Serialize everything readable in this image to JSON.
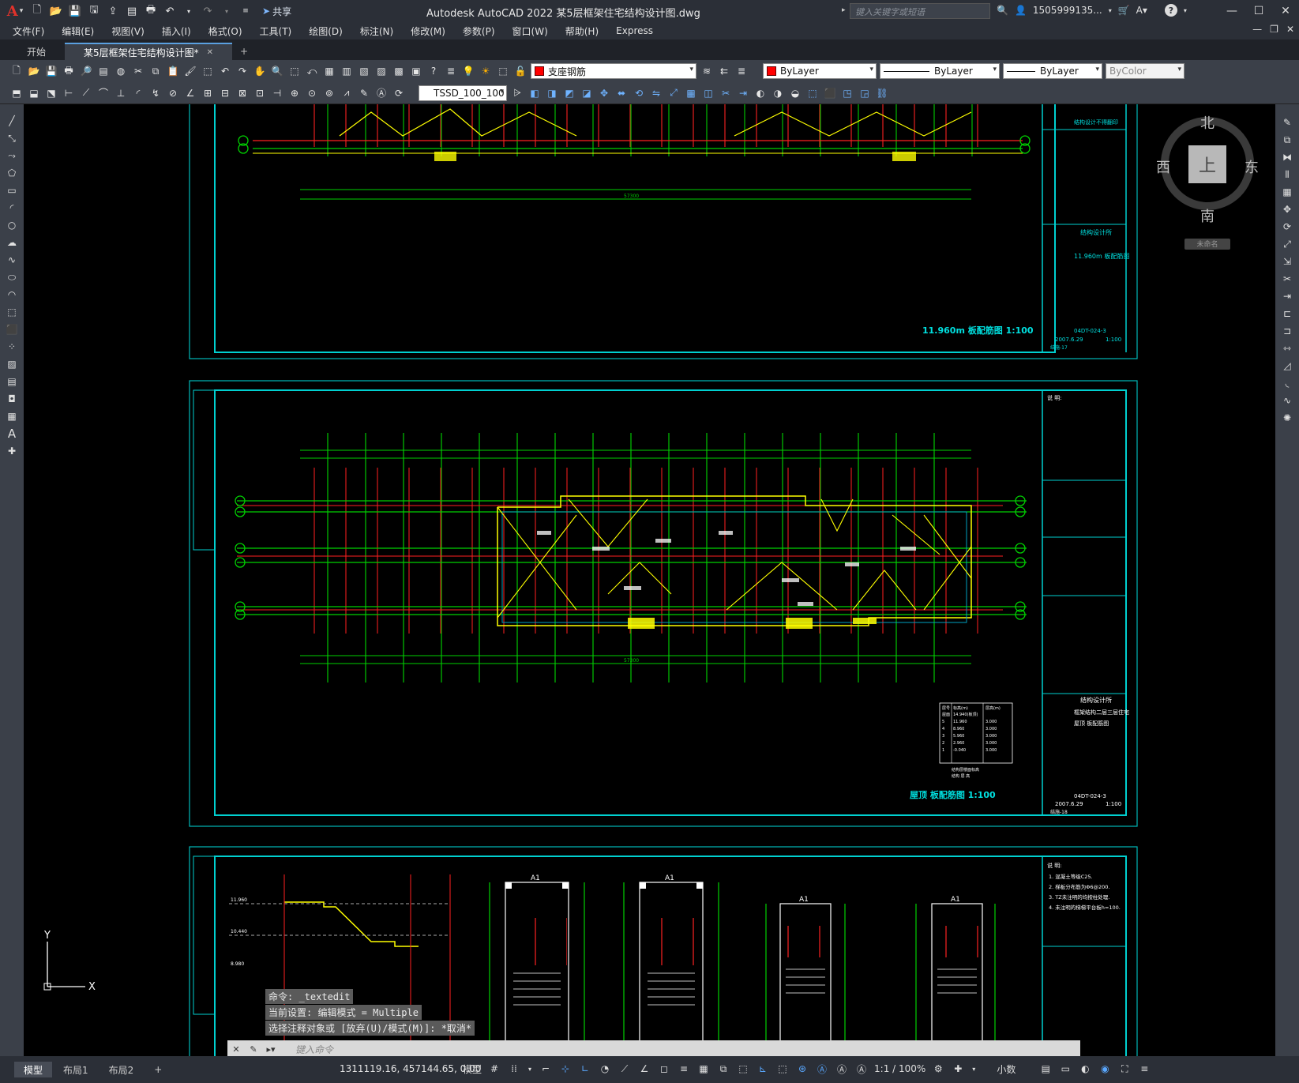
{
  "app": {
    "logo": "A",
    "title": "Autodesk AutoCAD 2022    某5层框架住宅结构设计图.dwg",
    "share_label": "共享",
    "search_placeholder": "键入关键字或短语",
    "user": "1505999135...",
    "help": "?"
  },
  "menu": [
    "文件(F)",
    "编辑(E)",
    "视图(V)",
    "插入(I)",
    "格式(O)",
    "工具(T)",
    "绘图(D)",
    "标注(N)",
    "修改(M)",
    "参数(P)",
    "窗口(W)",
    "帮助(H)",
    "Express"
  ],
  "tabs": [
    {
      "label": "开始",
      "active": false
    },
    {
      "label": "某5层框架住宅结构设计图*",
      "active": true
    },
    {
      "label": "+",
      "active": false
    }
  ],
  "properties": {
    "layer": "支座钢筋",
    "color": "ByLayer",
    "linetype": "ByLayer",
    "lineweight": "ByLayer",
    "plotstyle": "ByColor",
    "textstyle": "TSSD_100_100",
    "layer_color": "#ff0000"
  },
  "viewcube": {
    "north": "北",
    "south": "南",
    "east": "东",
    "west": "西",
    "face": "上",
    "wcs": "未命名"
  },
  "drawing": {
    "sheet1_title": "11.960m 板配筋图 1:100",
    "sheet2_title": "屋顶 板配筋图 1:100",
    "designer": "结构设计所",
    "sheet1_tb_label": "11.960m 板配筋图",
    "sheet2_tb_label1": "框架结构二层三层住宅",
    "sheet2_tb_label2": "屋顶 板配筋图",
    "drawing_no": "04DT-024-3",
    "date": "2007.6.29",
    "scale_a": "1:100",
    "sheet1_no": "结施-17",
    "sheet2_no": "结施-18",
    "total_dim": "57300",
    "ucs_x": "X",
    "ucs_y": "Y",
    "notes_title": "说 明:",
    "stair_notes": [
      "1. 混凝土等级C25.",
      "2. 梯板分布筋为Φ6@200.",
      "3. TZ未注明的均按柱处理.",
      "4. 未注明的梯梯平台板h=100."
    ],
    "stair_label": "A1",
    "elev_labels": [
      "11.960",
      "10.440",
      "8.980"
    ],
    "floor_table_header": [
      "层号",
      "标高(m)",
      "层高(m)"
    ],
    "floor_table": [
      [
        "屋面",
        "14.940(板顶)",
        ""
      ],
      [
        "5",
        "11.960",
        "3.000"
      ],
      [
        "4",
        "8.960",
        "3.000"
      ],
      [
        "3",
        "5.960",
        "3.000"
      ],
      [
        "2",
        "2.960",
        "3.000"
      ],
      [
        "1",
        "-0.040",
        "3.000"
      ]
    ],
    "floor_table_note": "结构层楼面标高",
    "floor_table_sub": "结构 层 高"
  },
  "command": {
    "history": [
      "命令: _textedit",
      "当前设置: 编辑模式 = Multiple",
      "选择注释对象或 [放弃(U)/模式(M)]: *取消*"
    ],
    "placeholder": "键入命令"
  },
  "status": {
    "layouts": [
      {
        "label": "模型",
        "active": true
      },
      {
        "label": "布局1",
        "active": false
      },
      {
        "label": "布局2",
        "active": false
      }
    ],
    "coords": "1311119.16, 457144.65, 0.00",
    "mode": "模型",
    "scale": "1:1 / 100%",
    "units": "小数"
  }
}
